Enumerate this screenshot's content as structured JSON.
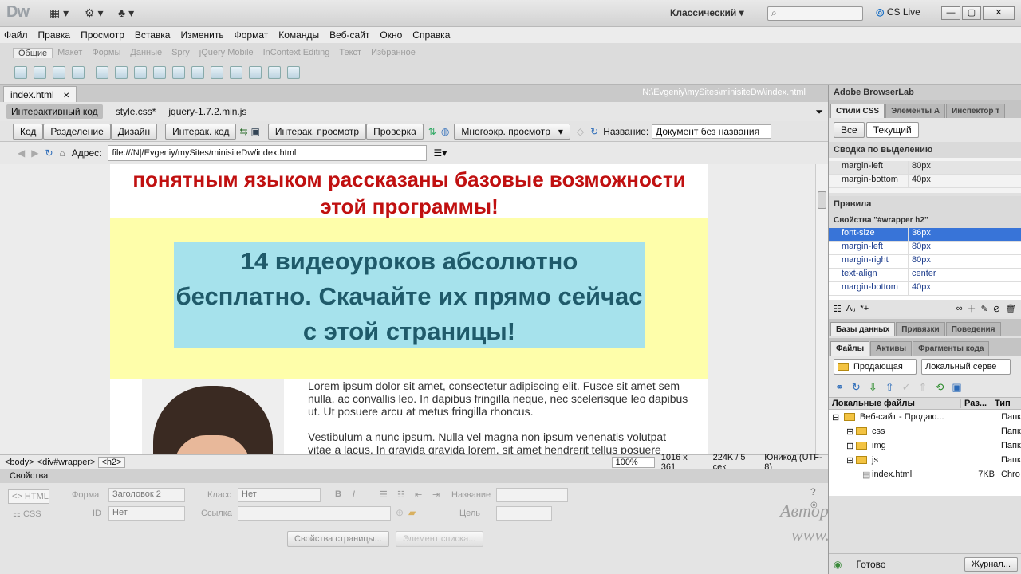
{
  "app": {
    "logo": "Dw",
    "workspace": "Классический",
    "cs_live": "CS Live"
  },
  "menu": [
    "Файл",
    "Правка",
    "Просмотр",
    "Вставка",
    "Изменить",
    "Формат",
    "Команды",
    "Веб-сайт",
    "Окно",
    "Справка"
  ],
  "insert_tabs": [
    "Общие",
    "Макет",
    "Формы",
    "Данные",
    "Spry",
    "jQuery Mobile",
    "InContext Editing",
    "Текст",
    "Избранное"
  ],
  "document": {
    "tab": "index.html",
    "path": "N:\\Evgeniy\\mySites\\minisiteDw\\index.html",
    "related_files": [
      "Интерактивный код",
      "style.css*",
      "jquery-1.7.2.min.js"
    ]
  },
  "toolbar": {
    "code": "Код",
    "split": "Разделение",
    "design": "Дизайн",
    "live_code": "Интерак. код",
    "live_view": "Интерак. просмотр",
    "check": "Проверка",
    "multiscreen": "Многоэкр. просмотр",
    "title_label": "Название:",
    "title_value": "Документ без названия"
  },
  "address": {
    "label": "Адрес:",
    "value": "file:///N|/Evgeniy/mySites/minisiteDw/index.html"
  },
  "page": {
    "intro": "понятным языком рассказаны базовые возможности этой программы!",
    "h2": "14 видеоуроков абсолютно бесплатно. Скачайте их прямо сейчас с этой страницы!",
    "para1": "Lorem ipsum dolor sit amet, consectetur adipiscing elit. Fusce sit amet sem nulla, ac convallis leo. In dapibus fringilla neque, nec scelerisque leo dapibus ut. Ut posuere arcu at metus fringilla rhoncus.",
    "para2": "Vestibulum a nunc ipsum. Nulla vel magna non ipsum venenatis volutpat vitae a lacus. In gravida gravida lorem, sit amet hendrerit tellus posuere"
  },
  "status": {
    "tags": [
      "<body>",
      "<div#wrapper>",
      "<h2>"
    ],
    "zoom": "100%",
    "size": "1016 x 361",
    "weight": "224K / 5 сек",
    "encoding": "Юникод (UTF-8)"
  },
  "properties": {
    "title": "Свойства",
    "html": "HTML",
    "css": "CSS",
    "format_label": "Формат",
    "format_value": "Заголовок 2",
    "id_label": "ID",
    "id_value": "Нет",
    "class_label": "Класс",
    "class_value": "Нет",
    "link_label": "Ссылка",
    "name_label": "Название",
    "target_label": "Цель",
    "page_props": "Свойства страницы...",
    "list_item": "Элемент списка..."
  },
  "watermark": {
    "author": "Автор: Евгений Попов",
    "site": "www.evgeniypopov.com"
  },
  "browserlab": "Adobe BrowserLab",
  "css_panel": {
    "tabs": [
      "Стили CSS",
      "Элементы А",
      "Инспектор т"
    ],
    "mode_all": "Все",
    "mode_current": "Текущий",
    "summary_title": "Сводка по выделению",
    "summary": [
      {
        "name": "margin-left",
        "value": "80px"
      },
      {
        "name": "margin-bottom",
        "value": "40px"
      }
    ],
    "rules_title": "Правила",
    "props_title": "Свойства \"#wrapper h2\"",
    "props": [
      {
        "name": "font-size",
        "value": "36px"
      },
      {
        "name": "margin-left",
        "value": "80px"
      },
      {
        "name": "margin-right",
        "value": "80px"
      },
      {
        "name": "text-align",
        "value": "center"
      },
      {
        "name": "margin-bottom",
        "value": "40px"
      }
    ]
  },
  "db_tabs": [
    "Базы данных",
    "Привязки",
    "Поведения"
  ],
  "files_panel": {
    "tabs": [
      "Файлы",
      "Активы",
      "Фрагменты кода"
    ],
    "site": "Продающая",
    "view": "Локальный серве",
    "col_local": "Локальные файлы",
    "col_size": "Раз...",
    "col_type": "Тип",
    "root": "Веб-сайт - Продаю...",
    "root_type": "Папк",
    "items": [
      {
        "name": "css",
        "size": "",
        "type": "Папк"
      },
      {
        "name": "img",
        "size": "",
        "type": "Папк"
      },
      {
        "name": "js",
        "size": "",
        "type": "Папк"
      },
      {
        "name": "index.html",
        "size": "7KB",
        "type": "Chro"
      }
    ],
    "ready": "Готово",
    "log": "Журнал..."
  }
}
